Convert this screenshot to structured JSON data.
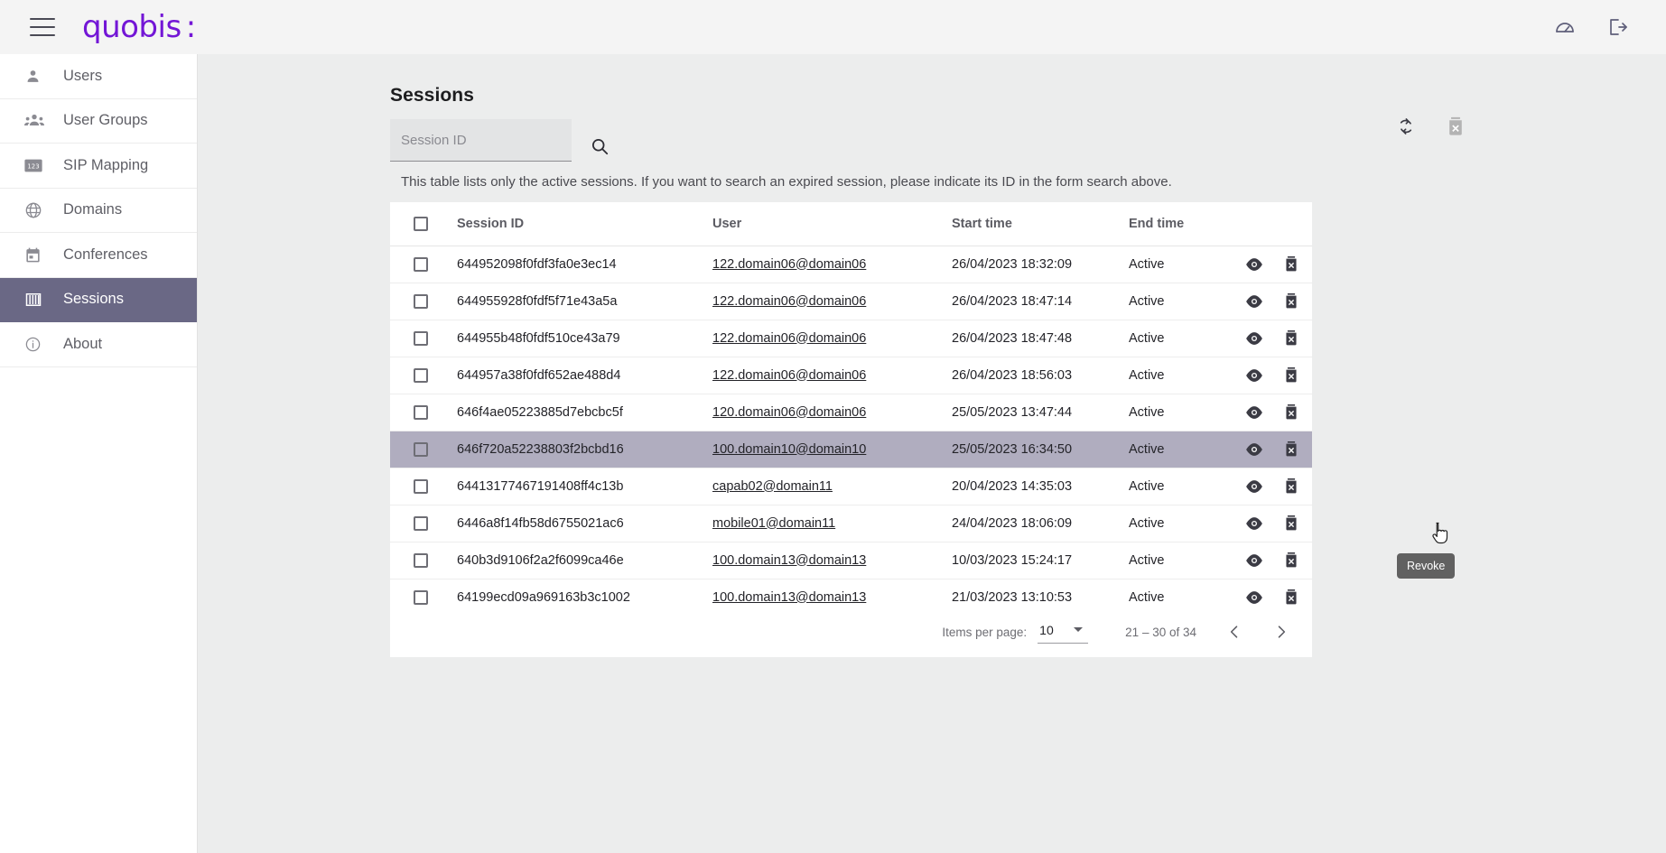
{
  "app": {
    "brand": "quobis",
    "brand_suffix": ":"
  },
  "topbar": {
    "menu_icon": "hamburger-menu-icon",
    "dashboard_icon": "speedometer-icon",
    "logout_icon": "logout-icon"
  },
  "sidebar": {
    "items": [
      {
        "label": "Users",
        "icon": "person-icon",
        "active": false
      },
      {
        "label": "User Groups",
        "icon": "people-icon",
        "active": false
      },
      {
        "label": "SIP Mapping",
        "icon": "123-icon",
        "active": false
      },
      {
        "label": "Domains",
        "icon": "globe-icon",
        "active": false
      },
      {
        "label": "Conferences",
        "icon": "calendar-icon",
        "active": false
      },
      {
        "label": "Sessions",
        "icon": "columns-icon",
        "active": true
      },
      {
        "label": "About",
        "icon": "info-icon",
        "active": false
      }
    ]
  },
  "main": {
    "title": "Sessions",
    "search": {
      "placeholder": "Session ID",
      "value": "",
      "search_icon": "search-icon"
    },
    "tools": {
      "refresh_icon": "refresh-icon",
      "delete_icon": "delete-disabled-icon"
    },
    "hint": "This table lists only the active sessions. If you want to search an expired session, please indicate its ID in the form search above.",
    "table": {
      "columns": [
        "Session ID",
        "User",
        "Start time",
        "End time"
      ],
      "rows": [
        {
          "session_id": "644952098f0fdf3fa0e3ec14",
          "user": "122.domain06@domain06",
          "start_time": "26/04/2023 18:32:09",
          "end_time": "Active",
          "selected": false,
          "highlight": false
        },
        {
          "session_id": "644955928f0fdf5f71e43a5a",
          "user": "122.domain06@domain06",
          "start_time": "26/04/2023 18:47:14",
          "end_time": "Active",
          "selected": false,
          "highlight": false
        },
        {
          "session_id": "644955b48f0fdf510ce43a79",
          "user": "122.domain06@domain06",
          "start_time": "26/04/2023 18:47:48",
          "end_time": "Active",
          "selected": false,
          "highlight": false
        },
        {
          "session_id": "644957a38f0fdf652ae488d4",
          "user": "122.domain06@domain06",
          "start_time": "26/04/2023 18:56:03",
          "end_time": "Active",
          "selected": false,
          "highlight": false
        },
        {
          "session_id": "646f4ae05223885d7ebcbc5f",
          "user": "120.domain06@domain06",
          "start_time": "25/05/2023 13:47:44",
          "end_time": "Active",
          "selected": false,
          "highlight": false
        },
        {
          "session_id": "646f720a52238803f2bcbd16",
          "user": "100.domain10@domain10",
          "start_time": "25/05/2023 16:34:50",
          "end_time": "Active",
          "selected": false,
          "highlight": true
        },
        {
          "session_id": "64413177467191408ff4c13b",
          "user": "capab02@domain11",
          "start_time": "20/04/2023 14:35:03",
          "end_time": "Active",
          "selected": false,
          "highlight": false
        },
        {
          "session_id": "6446a8f14fb58d6755021ac6",
          "user": "mobile01@domain11",
          "start_time": "24/04/2023 18:06:09",
          "end_time": "Active",
          "selected": false,
          "highlight": false
        },
        {
          "session_id": "640b3d9106f2a2f6099ca46e",
          "user": "100.domain13@domain13",
          "start_time": "10/03/2023 15:24:17",
          "end_time": "Active",
          "selected": false,
          "highlight": false
        },
        {
          "session_id": "64199ecd09a969163b3c1002",
          "user": "100.domain13@domain13",
          "start_time": "21/03/2023 13:10:53",
          "end_time": "Active",
          "selected": false,
          "highlight": false
        }
      ],
      "row_actions": {
        "view_icon": "eye-icon",
        "revoke_icon": "revoke-trash-icon"
      }
    },
    "paginator": {
      "items_per_page_label": "Items per page:",
      "items_per_page_value": "10",
      "range_label": "21 – 30 of 34",
      "prev_icon": "chevron-left-icon",
      "next_icon": "chevron-right-icon"
    },
    "tooltip": {
      "text": "Revoke"
    }
  },
  "colors": {
    "brand": "#7316d6",
    "active_nav": "#6a6885",
    "row_highlight": "#b0adbf",
    "page_bg": "#eceded",
    "tooltip_bg": "#616161"
  }
}
